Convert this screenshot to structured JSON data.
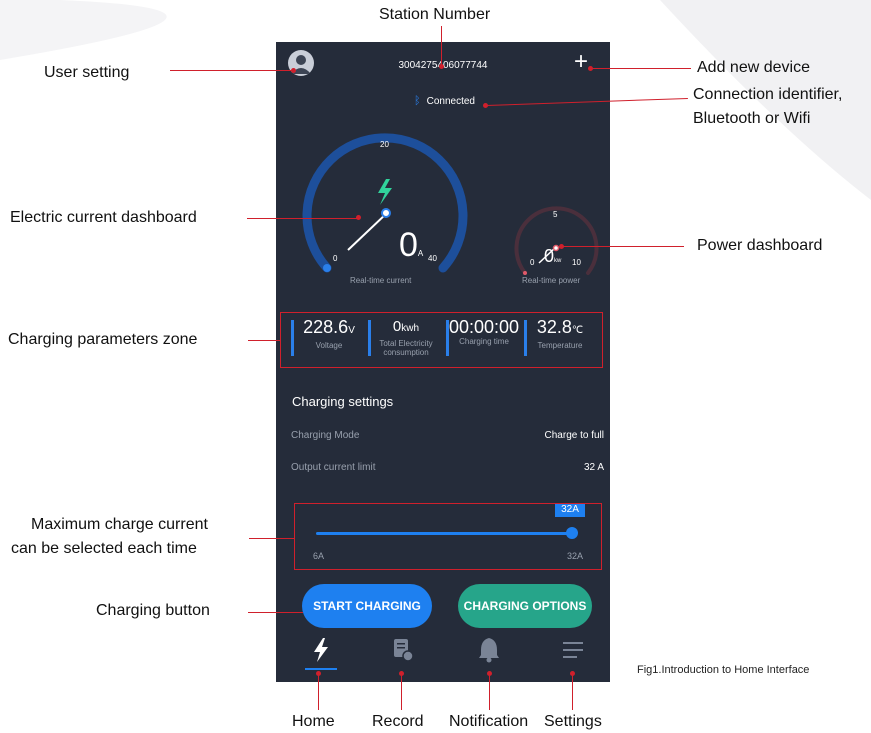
{
  "annotations": {
    "station_number": "Station Number",
    "user_setting": "User setting",
    "add_new_device": "Add new device",
    "connection_line1": "Connection identifier,",
    "connection_line2": "Bluetooth or Wifi",
    "current_dashboard": "Electric current dashboard",
    "power_dashboard": "Power dashboard",
    "charging_params": "Charging parameters zone",
    "max_current_line1": "Maximum charge current",
    "max_current_line2": "can be selected each time",
    "charging_button": "Charging button",
    "home": "Home",
    "record": "Record",
    "notification": "Notification",
    "settings": "Settings",
    "caption": "Fig1.Introduction to Home Interface"
  },
  "header": {
    "station_number": "3004275406077744",
    "connection_status": "Connected",
    "user_icon": "user-icon",
    "add_icon": "plus-icon",
    "connection_icon": "bluetooth-icon"
  },
  "current_gauge": {
    "min": "0",
    "mid": "20",
    "max": "40",
    "value": "0",
    "unit": "A",
    "label": "Real-time current",
    "level": 0.0
  },
  "power_gauge": {
    "min": "0",
    "mid": "5",
    "max": "10",
    "value": "0",
    "unit": "kw",
    "label": "Real-time power",
    "level": 0.0
  },
  "parameters": [
    {
      "value": "228.6",
      "unit": "V",
      "label": "Voltage"
    },
    {
      "value": "0",
      "unit": "kwh",
      "label": "Total Electricity consumption"
    },
    {
      "value": "00:00:00",
      "unit": "",
      "label": "Charging time"
    },
    {
      "value": "32.8",
      "unit": "℃",
      "label": "Temperature"
    }
  ],
  "settings": {
    "title": "Charging settings",
    "mode_label": "Charging Mode",
    "mode_value": "Charge to full",
    "limit_label": "Output current limit",
    "limit_value": "32 A"
  },
  "slider": {
    "tooltip": "32A",
    "min_label": "6A",
    "max_label": "32A",
    "value_fraction": 1.0
  },
  "buttons": {
    "start": "START CHARGING",
    "options": "CHARGING OPTIONS"
  },
  "nav": {
    "home_icon": "lightning-icon",
    "record_icon": "record-icon",
    "notification_icon": "bell-icon",
    "settings_icon": "menu-icon"
  },
  "colors": {
    "phone_bg": "#252c3a",
    "accent_blue": "#1e80f0",
    "accent_green": "#26a58a",
    "annotation_red": "#d0202c"
  }
}
